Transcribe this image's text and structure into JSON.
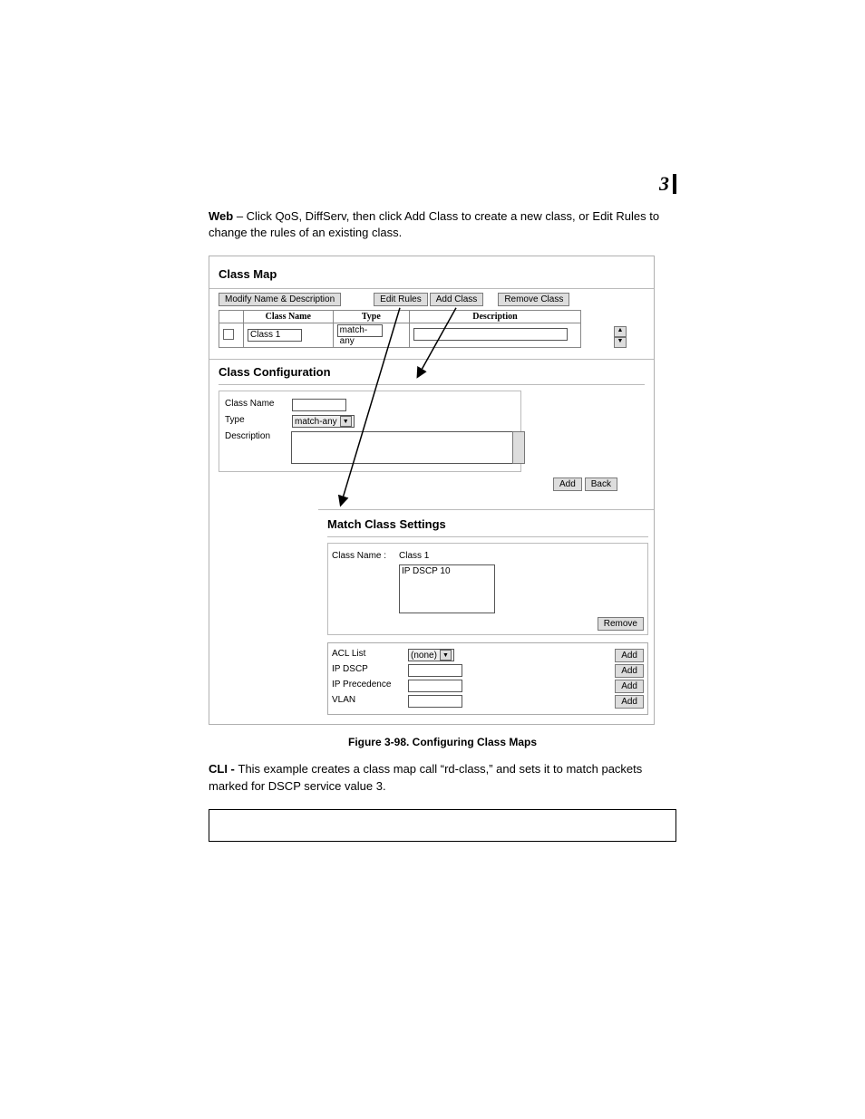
{
  "page": {
    "chapter_number": "3"
  },
  "intro": {
    "web_bold": "Web",
    "web_text": " – Click QoS, DiffServ, then click Add Class to create a new class, or Edit Rules to change the rules of an existing class."
  },
  "class_map": {
    "title": "Class Map",
    "buttons": {
      "modify": "Modify Name & Description",
      "edit_rules": "Edit Rules",
      "add_class": "Add Class",
      "remove_class": "Remove Class"
    },
    "columns": {
      "class_name": "Class Name",
      "type": "Type",
      "description": "Description"
    },
    "row": {
      "class_name_value": "Class 1",
      "type_value": "match-any",
      "description_value": ""
    }
  },
  "class_config": {
    "title": "Class Configuration",
    "labels": {
      "class_name": "Class Name",
      "type": "Type",
      "description": "Description"
    },
    "type_value": "match-any",
    "buttons": {
      "add": "Add",
      "back": "Back"
    }
  },
  "match_settings": {
    "title": "Match Class Settings",
    "labels": {
      "class_name": "Class Name :",
      "acl_list": "ACL List",
      "ip_dscp": "IP DSCP",
      "ip_precedence": "IP Precedence",
      "vlan": "VLAN"
    },
    "class_name_value": "Class 1",
    "rule_item": "IP DSCP 10",
    "acl_value": "(none)",
    "buttons": {
      "remove": "Remove",
      "add": "Add"
    }
  },
  "figure": {
    "caption": "Figure 3-98.  Configuring Class Maps"
  },
  "cli": {
    "bold": "CLI - ",
    "text": "This example creates a class map call “rd-class,” and sets it to match packets marked for DSCP service value 3."
  }
}
